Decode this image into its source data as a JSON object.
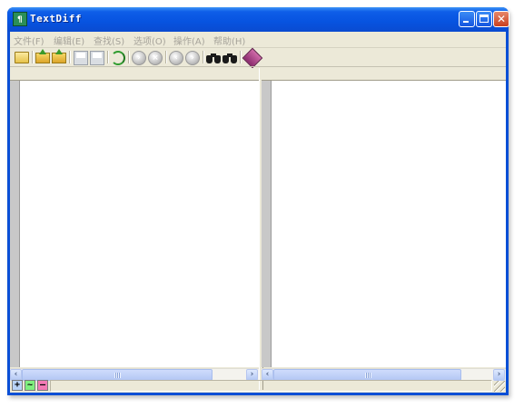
{
  "window": {
    "title": "TextDiff",
    "app_icon": "notepad-diff-icon",
    "buttons": [
      "minimize",
      "maximize",
      "close"
    ],
    "close_glyph": "✕"
  },
  "menu": [
    {
      "label": "文件(F)"
    },
    {
      "label": "编辑(E)"
    },
    {
      "label": "查找(S)"
    },
    {
      "label": "选项(O)"
    },
    {
      "label": "操作(A)"
    },
    {
      "label": "帮助(H)"
    }
  ],
  "toolbar": {
    "icons": [
      "open-folder-icon",
      "open-left-icon",
      "open-right-icon",
      "save-left-icon",
      "save-right-icon",
      "refresh-icon",
      "nav-first-icon",
      "nav-cancel-icon",
      "nav-prev-icon",
      "nav-next-icon",
      "find-icon",
      "find-next-icon",
      "help-book-icon"
    ]
  },
  "panes": {
    "left": {
      "content": ""
    },
    "right": {
      "content": ""
    }
  },
  "statusbar": {
    "legend": [
      {
        "symbol": "+",
        "meaning": "added",
        "color": "#b9d3f7"
      },
      {
        "symbol": "~",
        "meaning": "modified",
        "color": "#7ff07f"
      },
      {
        "symbol": "–",
        "meaning": "deleted",
        "color": "#f27ab5"
      }
    ]
  },
  "colors": {
    "titlebar": "#0753e0",
    "chrome": "#ece9d8",
    "disabled_text": "#a6a39a"
  }
}
